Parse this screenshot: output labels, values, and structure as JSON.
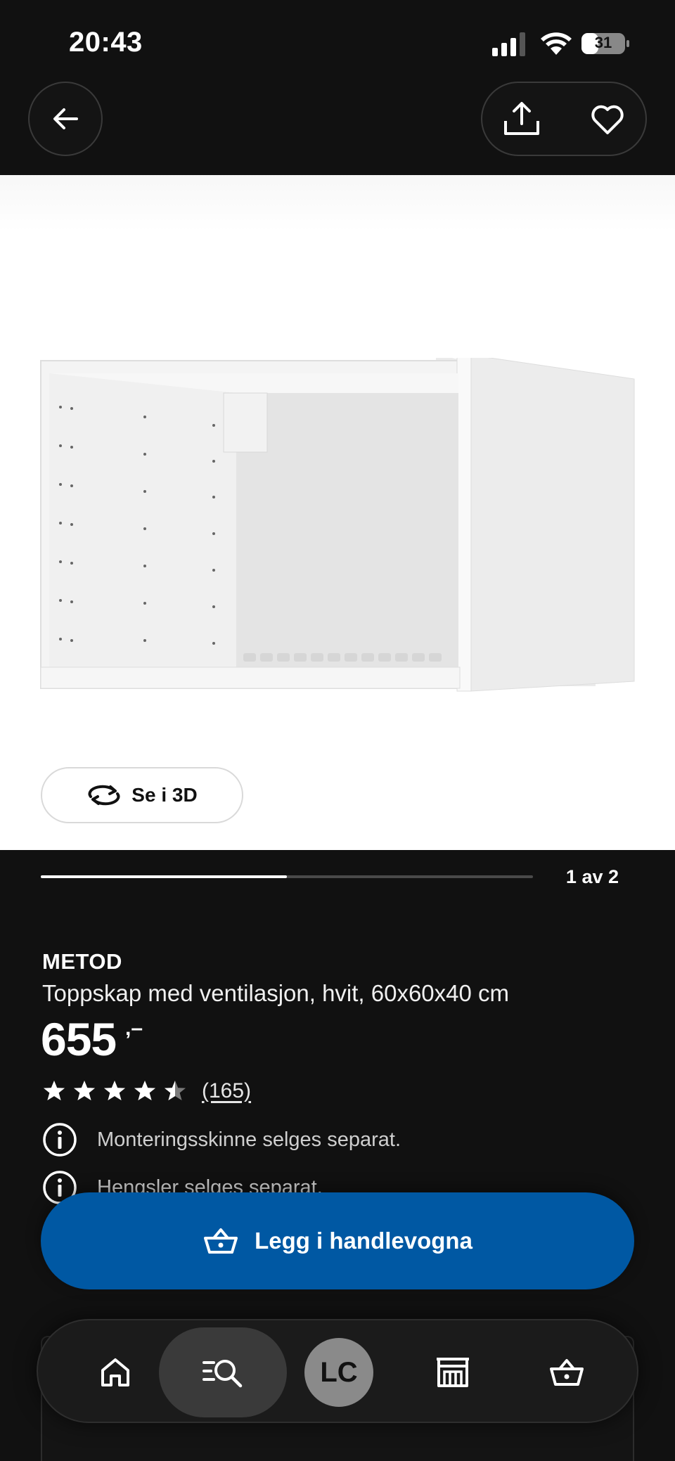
{
  "status_bar": {
    "time": "20:43",
    "battery_level": "31"
  },
  "top_bar": {
    "back_icon": "arrow-left-icon",
    "share_icon": "share-icon",
    "favorite_icon": "heart-icon"
  },
  "gallery": {
    "see_3d_label": "Se i 3D",
    "page_indicator": "1 av 2",
    "progress_fraction": 0.5
  },
  "product": {
    "brand": "METOD",
    "description": "Toppskap med ventilasjon, hvit, 60x60x40 cm",
    "price": "655",
    "price_suffix": ",–",
    "rating": 4.5,
    "review_count": "(165)",
    "info": [
      {
        "icon": "info-icon",
        "text": "Monteringsskinne selges separat."
      },
      {
        "icon": "info-icon",
        "text": "Hengsler selges separat."
      }
    ]
  },
  "cart_button": {
    "label": "Legg i handlevogna",
    "icon": "basket-icon"
  },
  "bottom_nav": {
    "items": [
      {
        "name": "home",
        "icon": "home-icon"
      },
      {
        "name": "search",
        "icon": "search-icon"
      },
      {
        "name": "profile",
        "initials": "LC"
      },
      {
        "name": "stores",
        "icon": "store-icon"
      },
      {
        "name": "cart",
        "icon": "basket-icon"
      }
    ]
  },
  "colors": {
    "accent_blue": "#0058a3",
    "background": "#111111"
  }
}
